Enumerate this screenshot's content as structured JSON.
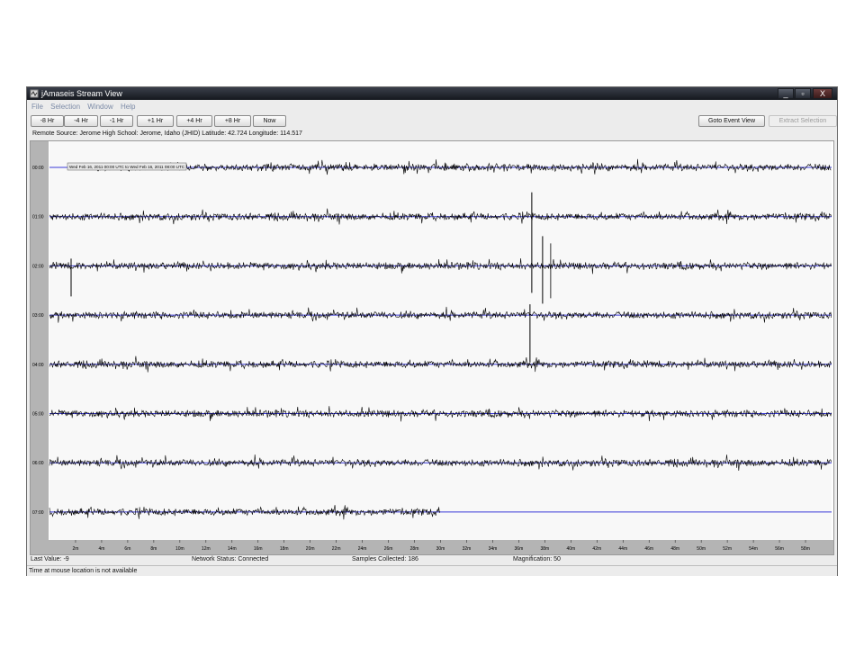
{
  "window": {
    "title": "jAmaseis Stream View",
    "controls": [
      "_",
      "▫",
      "X"
    ]
  },
  "menu": [
    "File",
    "Selection",
    "Window",
    "Help"
  ],
  "toolbar": {
    "left_buttons": [
      "-8 Hr",
      "-4 Hr",
      "-1 Hr",
      "+1 Hr",
      "+4 Hr",
      "+8 Hr",
      "Now"
    ],
    "goto_event": "Goto Event View",
    "extract_selection": "Extract Selection"
  },
  "source_line": "Remote Source: Jerome High School: Jerome, Idaho (JHID) Latitude: 42.724 Longitude: 114.517",
  "plot": {
    "hour_labels": [
      "00:00",
      "01:00",
      "02:00",
      "03:00",
      "04:00",
      "05:00",
      "06:00",
      "07:00"
    ],
    "minute_ticks": [
      "2m",
      "4m",
      "6m",
      "8m",
      "10m",
      "12m",
      "14m",
      "16m",
      "18m",
      "20m",
      "22m",
      "24m",
      "26m",
      "28m",
      "30m",
      "32m",
      "34m",
      "36m",
      "38m",
      "40m",
      "42m",
      "44m",
      "46m",
      "48m",
      "50m",
      "52m",
      "54m",
      "56m",
      "58m"
    ],
    "range_tag": "Wed Feb 16, 2011 00:00 UTC to Wed Feb 16, 2011 08:00 UTC",
    "last_row_fraction": 0.5,
    "colors": {
      "trace": "#000000",
      "baseline": "#3a3ad8",
      "background": "#f8f8f8"
    }
  },
  "status": {
    "last_value": "Last Value:  -9",
    "network": "Network Status:  Connected",
    "samples": "Samples Collected:  186",
    "magnification": "Magnification:  50"
  },
  "mouse_status": "Time at mouse location is not available"
}
